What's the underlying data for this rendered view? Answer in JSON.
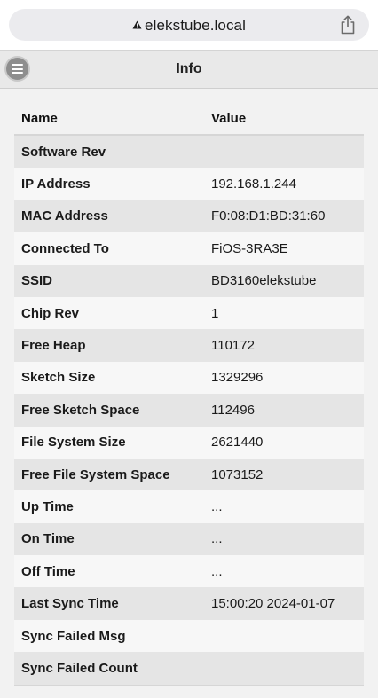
{
  "browser": {
    "url": "elekstube.local"
  },
  "header": {
    "title": "Info"
  },
  "table": {
    "columns": [
      "Name",
      "Value"
    ],
    "rows": [
      {
        "name": "Software Rev",
        "value": ""
      },
      {
        "name": "IP Address",
        "value": "192.168.1.244"
      },
      {
        "name": "MAC Address",
        "value": "F0:08:D1:BD:31:60"
      },
      {
        "name": "Connected To",
        "value": "FiOS-3RA3E"
      },
      {
        "name": "SSID",
        "value": "BD3160elekstube"
      },
      {
        "name": "Chip Rev",
        "value": "1"
      },
      {
        "name": "Free Heap",
        "value": "110172"
      },
      {
        "name": "Sketch Size",
        "value": "1329296"
      },
      {
        "name": "Free Sketch Space",
        "value": "112496"
      },
      {
        "name": "File System Size",
        "value": "2621440"
      },
      {
        "name": "Free File System Space",
        "value": "1073152"
      },
      {
        "name": "Up Time",
        "value": "..."
      },
      {
        "name": "On Time",
        "value": "..."
      },
      {
        "name": "Off Time",
        "value": "..."
      },
      {
        "name": "Last Sync Time",
        "value": "15:00:20 2024-01-07"
      },
      {
        "name": "Sync Failed Msg",
        "value": ""
      },
      {
        "name": "Sync Failed Count",
        "value": ""
      }
    ]
  }
}
